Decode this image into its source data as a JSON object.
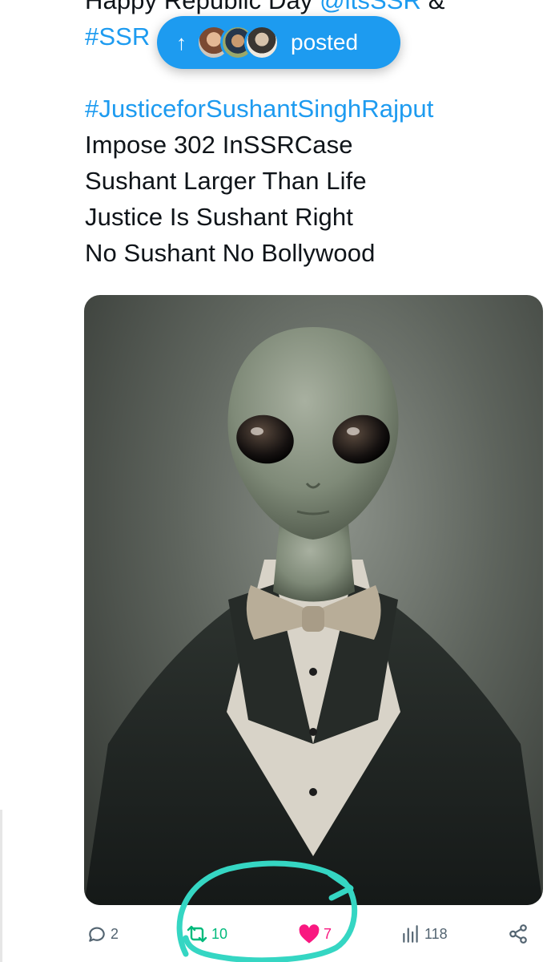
{
  "tweet": {
    "lines": [
      {
        "parts": [
          {
            "text": "Happy Republic Day ",
            "link": false
          },
          {
            "text": "@itsSSR",
            "link": true
          },
          {
            "text": " &",
            "link": false
          }
        ]
      },
      {
        "parts": [
          {
            "text": "#SSR",
            "link": true
          }
        ]
      },
      {
        "parts": [
          {
            "text": "#JusticeforSushantSinghRajput",
            "link": true
          }
        ]
      },
      {
        "parts": [
          {
            "text": "Impose 302 InSSRCase",
            "link": false
          }
        ]
      },
      {
        "parts": [
          {
            "text": "Sushant Larger Than Life",
            "link": false
          }
        ]
      },
      {
        "parts": [
          {
            "text": "Justice Is Sushant Right",
            "link": false
          }
        ]
      },
      {
        "parts": [
          {
            "text": "No Sushant No Bollywood",
            "link": false
          }
        ]
      }
    ]
  },
  "new_posts_pill": {
    "arrow": "↑",
    "label": "posted",
    "avatars": [
      "avatar-1",
      "avatar-2",
      "avatar-3"
    ]
  },
  "media": {
    "subject": "alien-in-tuxedo-image"
  },
  "actions": {
    "reply_count": "2",
    "retweet_count": "10",
    "like_count": "7",
    "view_count": "118"
  },
  "icons": {
    "reply": "reply-icon",
    "retweet": "retweet-icon",
    "like": "heart-icon",
    "views": "views-icon",
    "share": "share-icon"
  },
  "colors": {
    "link": "#1d9bf0",
    "pill": "#1d9bf0",
    "retweet": "#00ba7c",
    "like": "#f91880",
    "muted": "#536471",
    "annotation": "#35d6c3"
  }
}
